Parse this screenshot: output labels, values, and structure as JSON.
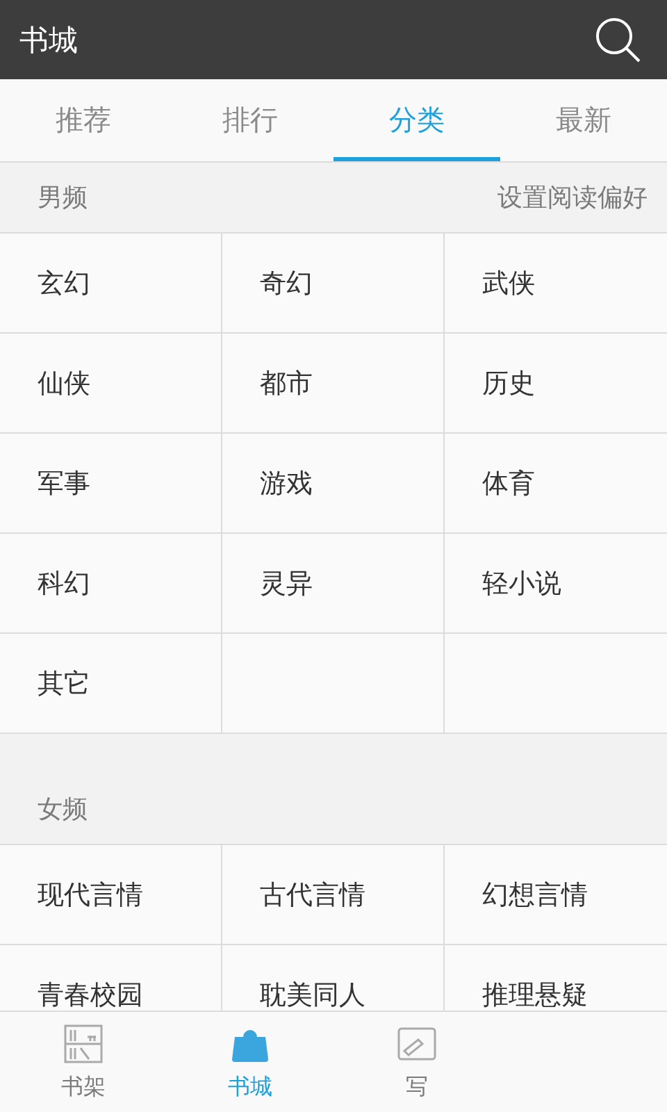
{
  "header": {
    "title": "书城"
  },
  "tabs": [
    {
      "label": "推荐",
      "selected": false
    },
    {
      "label": "排行",
      "selected": false
    },
    {
      "label": "分类",
      "selected": true
    },
    {
      "label": "最新",
      "selected": false
    }
  ],
  "sections": [
    {
      "title": "男频",
      "action": "设置阅读偏好",
      "categories": [
        "玄幻",
        "奇幻",
        "武侠",
        "仙侠",
        "都市",
        "历史",
        "军事",
        "游戏",
        "体育",
        "科幻",
        "灵异",
        "轻小说",
        "其它"
      ]
    },
    {
      "title": "女频",
      "categories": [
        "现代言情",
        "古代言情",
        "幻想言情",
        "青春校园",
        "耽美同人",
        "推理悬疑"
      ]
    }
  ],
  "bottom_nav": [
    {
      "label": "书架",
      "kind": "shelf",
      "selected": false
    },
    {
      "label": "书城",
      "kind": "store",
      "selected": true
    },
    {
      "label": "写",
      "kind": "write",
      "selected": false
    }
  ]
}
